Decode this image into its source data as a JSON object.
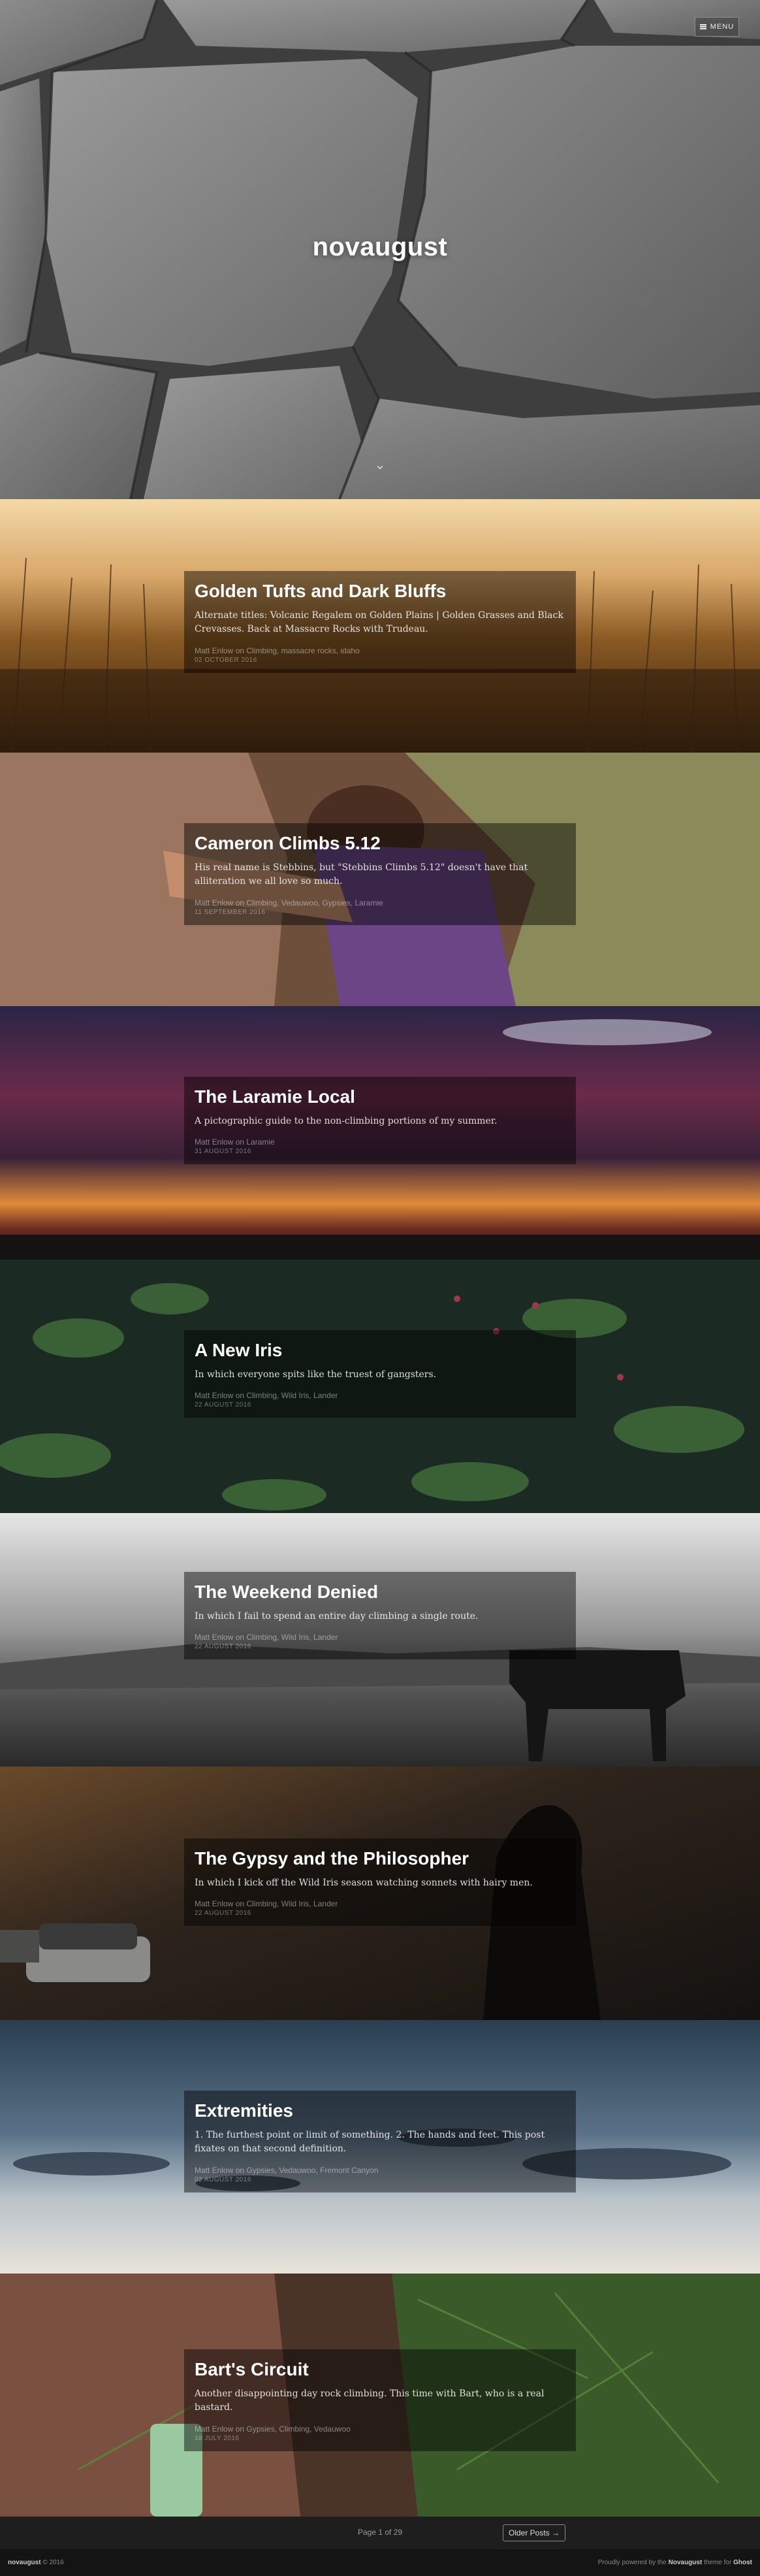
{
  "header": {
    "site_title": "novaugust",
    "menu_label": "MENU"
  },
  "posts": [
    {
      "title": "Golden Tufts and Dark Bluffs",
      "excerpt": "Alternate titles: Volcanic Regalem on Golden Plains | Golden Grasses and Black Crevasses. Back at Massacre Rocks with Trudeau.",
      "meta": "Matt Enlow on Climbing, massacre rocks, idaho",
      "date": "02 OCTOBER 2016"
    },
    {
      "title": "Cameron Climbs 5.12",
      "excerpt": "His real name is Stebbins, but \"Stebbins Climbs 5.12\" doesn't have that alliteration we all love so much.",
      "meta": "Matt Enlow on Climbing, Vedauwoo, Gypsies, Laramie",
      "date": "11 SEPTEMBER 2016"
    },
    {
      "title": "The Laramie Local",
      "excerpt": "A pictographic guide to the non-climbing portions of my summer.",
      "meta": "Matt Enlow on Laramie",
      "date": "31 AUGUST 2016"
    },
    {
      "title": "A New Iris",
      "excerpt": "In which everyone spits like the truest of gangsters.",
      "meta": "Matt Enlow on Climbing, Wild Iris, Lander",
      "date": "22 AUGUST 2016"
    },
    {
      "title": "The Weekend Denied",
      "excerpt": "In which I fail to spend an entire day climbing a single route.",
      "meta": "Matt Enlow on Climbing, Wild Iris, Lander",
      "date": "22 AUGUST 2016"
    },
    {
      "title": "The Gypsy and the Philosopher",
      "excerpt": "In which I kick off the Wild Iris season watching sonnets with hairy men.",
      "meta": "Matt Enlow on Climbing, Wild Iris, Lander",
      "date": "22 AUGUST 2016"
    },
    {
      "title": "Extremities",
      "excerpt": "1. The furthest point or limit of something. 2. The hands and feet. This post fixates on that second definition.",
      "meta": "Matt Enlow on Gypsies, Vedauwoo, Fremont Canyon",
      "date": "02 AUGUST 2016"
    },
    {
      "title": "Bart's Circuit",
      "excerpt": "Another disappointing day rock climbing. This time with Bart, who is a real bastard.",
      "meta": "Matt Enlow on Gypsies, Climbing, Vedauwoo",
      "date": "18 JULY 2016"
    }
  ],
  "pagination": {
    "page_label": "Page 1 of 29",
    "older_label": "Older Posts →"
  },
  "footer": {
    "site": "novaugust",
    "copyright": "© 2016",
    "powered_prefix": "Proudly powered by the",
    "theme": "Novaugust",
    "powered_mid": "theme for",
    "platform": "Ghost"
  },
  "colors": {
    "page_background": "#1b1b1b",
    "card_background": "rgba(0,0,0,0.45)"
  }
}
